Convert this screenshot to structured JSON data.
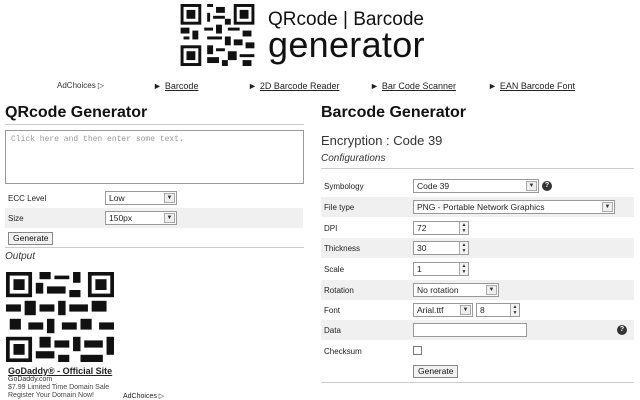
{
  "header": {
    "title_line1": "QRcode | Barcode",
    "title_line2": "generator"
  },
  "nav": {
    "adchoices": "AdChoices ▷",
    "links": [
      {
        "arrow": "►",
        "label": "Barcode"
      },
      {
        "arrow": "►",
        "label": "2D Barcode Reader"
      },
      {
        "arrow": "►",
        "label": "Bar Code Scanner"
      },
      {
        "arrow": "►",
        "label": "EAN Barcode Font"
      }
    ]
  },
  "qr": {
    "heading": "QRcode Generator",
    "textarea_placeholder": "Click here and then enter some text.",
    "ecc_label": "ECC Level",
    "ecc_value": "Low",
    "size_label": "Size",
    "size_value": "150px",
    "generate_label": "Generate",
    "output_label": "Output"
  },
  "ad": {
    "title": "GoDaddy® - Official Site",
    "url": "GoDaddy.com",
    "line1": "$7.99 Limited Time Domain Sale",
    "line2": "Register Your Domain Now!",
    "adchoices": "AdChoices ▷"
  },
  "barcode": {
    "heading": "Barcode Generator",
    "encryption": "Encryption : Code 39",
    "configurations": "Configurations",
    "symbology_label": "Symbology",
    "symbology_value": "Code 39",
    "filetype_label": "File type",
    "filetype_value": "PNG - Portable Network Graphics",
    "dpi_label": "DPI",
    "dpi_value": "72",
    "thickness_label": "Thickness",
    "thickness_value": "30",
    "scale_label": "Scale",
    "scale_value": "1",
    "rotation_label": "Rotation",
    "rotation_value": "No rotation",
    "font_label": "Font",
    "font_value": "Arial.ttf",
    "font_size_value": "8",
    "data_label": "Data",
    "data_value": "",
    "checksum_label": "Checksum",
    "checksum_checked": false,
    "generate_label": "Generate",
    "help_glyph": "?"
  }
}
